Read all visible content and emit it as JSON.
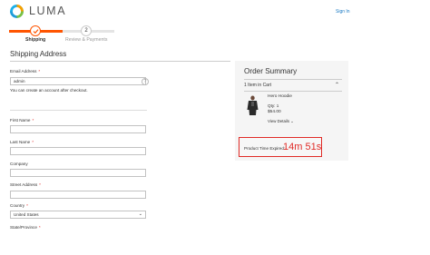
{
  "header": {
    "brand": "LUMA",
    "signin_label": "Sign In"
  },
  "progress": {
    "steps": [
      {
        "number": "",
        "label": "Shipping",
        "state": "completed"
      },
      {
        "number": "2",
        "label": "Review & Payments",
        "state": "upcoming"
      }
    ],
    "accent_color": "#ff5501"
  },
  "form": {
    "title": "Shipping Address",
    "email": {
      "label": "Email Address",
      "value": "admin",
      "note": "You can create an account after checkout."
    },
    "first_name": {
      "label": "First Name",
      "value": ""
    },
    "last_name": {
      "label": "Last Name",
      "value": ""
    },
    "company": {
      "label": "Company",
      "value": ""
    },
    "street": {
      "label": "Street Address",
      "value": ""
    },
    "country": {
      "label": "Country",
      "value": "United States"
    },
    "state": {
      "label": "State/Province"
    }
  },
  "summary": {
    "title": "Order Summary",
    "cart_count": "1 Item in Cart",
    "product": {
      "name": "Hero Hoodie",
      "qty": "Qty: 1",
      "price": "$54.00",
      "details_label": "View Details"
    },
    "timer": {
      "label": "Product Time Expired:",
      "value": "14m 51s",
      "color": "#e02b27"
    }
  },
  "icons": {
    "logo": "luma-logo-icon",
    "check": "check-icon",
    "help": "help-icon",
    "chevron_up": "chevron-up-icon",
    "chevron_down": "chevron-down-icon"
  }
}
